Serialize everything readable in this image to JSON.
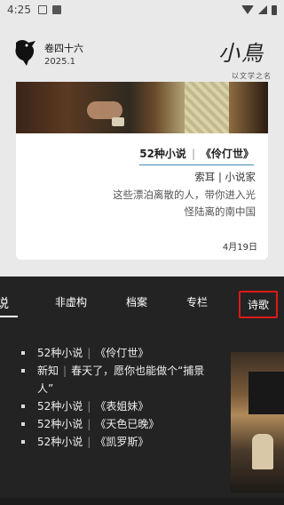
{
  "status_bar": {
    "time": "4:25"
  },
  "header": {
    "issue_title": "卷四十六",
    "issue_date": "2025.1",
    "brand_logo": "小鳥",
    "brand_sub": "以文学之名"
  },
  "card": {
    "category": "52种小说",
    "separator": "|",
    "title": "《伶仃世》",
    "author": "索耳 | 小说家",
    "desc_line1": "这些漂泊离散的人，带你进入光",
    "desc_line2": "怪陆离的南中国",
    "date": "4月19日"
  },
  "tabs": [
    {
      "label": "说"
    },
    {
      "label": "非虚构"
    },
    {
      "label": "档案"
    },
    {
      "label": "专栏"
    },
    {
      "label": "诗歌"
    }
  ],
  "links": [
    {
      "prefix": "52种小说",
      "sep": "|",
      "title": "《伶仃世》"
    },
    {
      "prefix": "新知",
      "sep": "|",
      "title": "春天了，愿你也能做个“捕景人”"
    },
    {
      "prefix": "52种小说",
      "sep": "|",
      "title": "《表姐妹》"
    },
    {
      "prefix": "52种小说",
      "sep": "|",
      "title": "《天色已晚》"
    },
    {
      "prefix": "52种小说",
      "sep": "|",
      "title": "《凯罗斯》"
    }
  ],
  "colors": {
    "highlight_border": "#e01818",
    "heading_underline": "#4a8ab8",
    "dark_bg": "#232323"
  }
}
